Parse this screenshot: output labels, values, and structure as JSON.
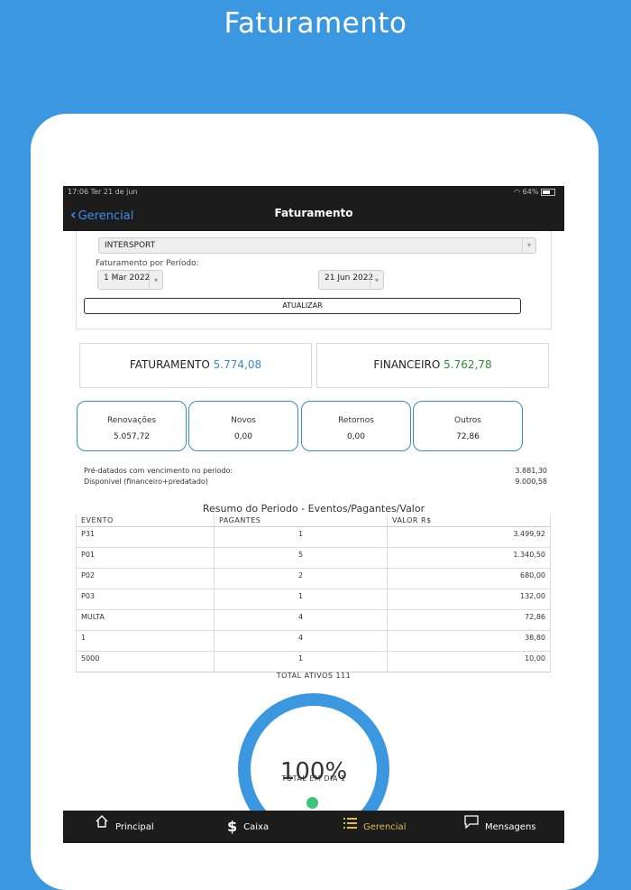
{
  "hero_title": "Faturamento",
  "status_bar": {
    "time_date": "17:06  Ter 21 de jun",
    "battery": "64%"
  },
  "nav": {
    "back_label": "Gerencial",
    "title": "Faturamento"
  },
  "filters": {
    "company": "INTERSPORT",
    "period_label": "Faturamento por Período:",
    "start_date": "1 Mar 2022",
    "end_date": "21 Jun 2022",
    "update_label": "ATUALIZAR"
  },
  "summary": {
    "faturamento_label": "FATURAMENTO",
    "faturamento_value": "5.774,08",
    "financeiro_label": "FINANCEIRO",
    "financeiro_value": "5.762,78"
  },
  "kpis": [
    {
      "label": "Renovações",
      "value": "5.057,72"
    },
    {
      "label": "Novos",
      "value": "0,00"
    },
    {
      "label": "Retornos",
      "value": "0,00"
    },
    {
      "label": "Outros",
      "value": "72,86"
    }
  ],
  "info": [
    {
      "label": "Pré-datados com vencimento no periodo:",
      "value": "3.881,30"
    },
    {
      "label": "Disponivel (financeiro+predatado)",
      "value": "9.000,58"
    }
  ],
  "table": {
    "title": "Resumo do Periodo - Eventos/Pagantes/Valor",
    "headers": [
      "EVENTO",
      "PAGANTES",
      "VALOR R$"
    ],
    "rows": [
      [
        "P31",
        "1",
        "3.499,92"
      ],
      [
        "P01",
        "5",
        "1.340,50"
      ],
      [
        "P02",
        "2",
        "680,00"
      ],
      [
        "P03",
        "1",
        "132,00"
      ],
      [
        "MULTA",
        "4",
        "72,86"
      ],
      [
        "1",
        "4",
        "38,80"
      ],
      [
        "5000",
        "1",
        "10,00"
      ]
    ]
  },
  "gauge": {
    "total_label": "TOTAL ATIVOS 111",
    "percent_text": "100%",
    "percent_value": 100,
    "sub_label": "TOTAL EM DIA 1",
    "ring_color": "#3a97e0",
    "dot_color": "#3cc47a"
  },
  "tabs": [
    {
      "label": "Principal",
      "icon": "home-icon"
    },
    {
      "label": "Caixa",
      "icon": "dollar-icon"
    },
    {
      "label": "Gerencial",
      "icon": "list-icon",
      "active": true
    },
    {
      "label": "Mensagens",
      "icon": "chat-icon"
    }
  ],
  "colors": {
    "brand_blue": "#3a97e0",
    "value_blue": "#3a88c8",
    "value_green": "#2e8b2e",
    "tab_active": "#e3b94b"
  }
}
